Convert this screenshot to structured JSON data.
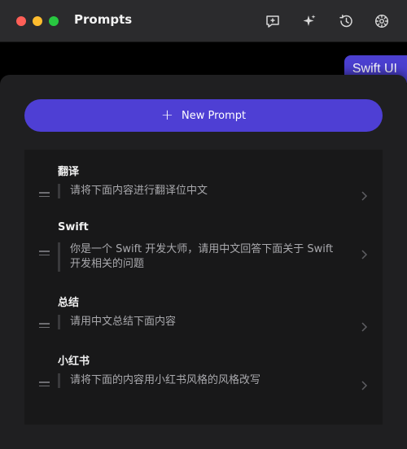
{
  "window": {
    "title": "Prompts"
  },
  "toolbar": {
    "icons": [
      "new-chat-icon",
      "sparkles-icon",
      "history-icon",
      "settings-gear-icon"
    ]
  },
  "chat": {
    "bubble_text": "Swift UI"
  },
  "panel": {
    "new_prompt_label": "New Prompt",
    "items": [
      {
        "title": "翻译",
        "content": "请将下面内容进行翻译位中文"
      },
      {
        "title": "Swift",
        "content": "你是一个 Swift 开发大师，请用中文回答下面关于 Swift 开发相关的问题"
      },
      {
        "title": "总结",
        "content": "请用中文总结下面内容"
      },
      {
        "title": "小红书",
        "content": "请将下面的内容用小红书风格的风格改写"
      }
    ]
  },
  "colors": {
    "accent": "#4e3fd4",
    "titlebar": "#2b2b2d",
    "panel": "#1f1f21",
    "list": "#181819"
  }
}
